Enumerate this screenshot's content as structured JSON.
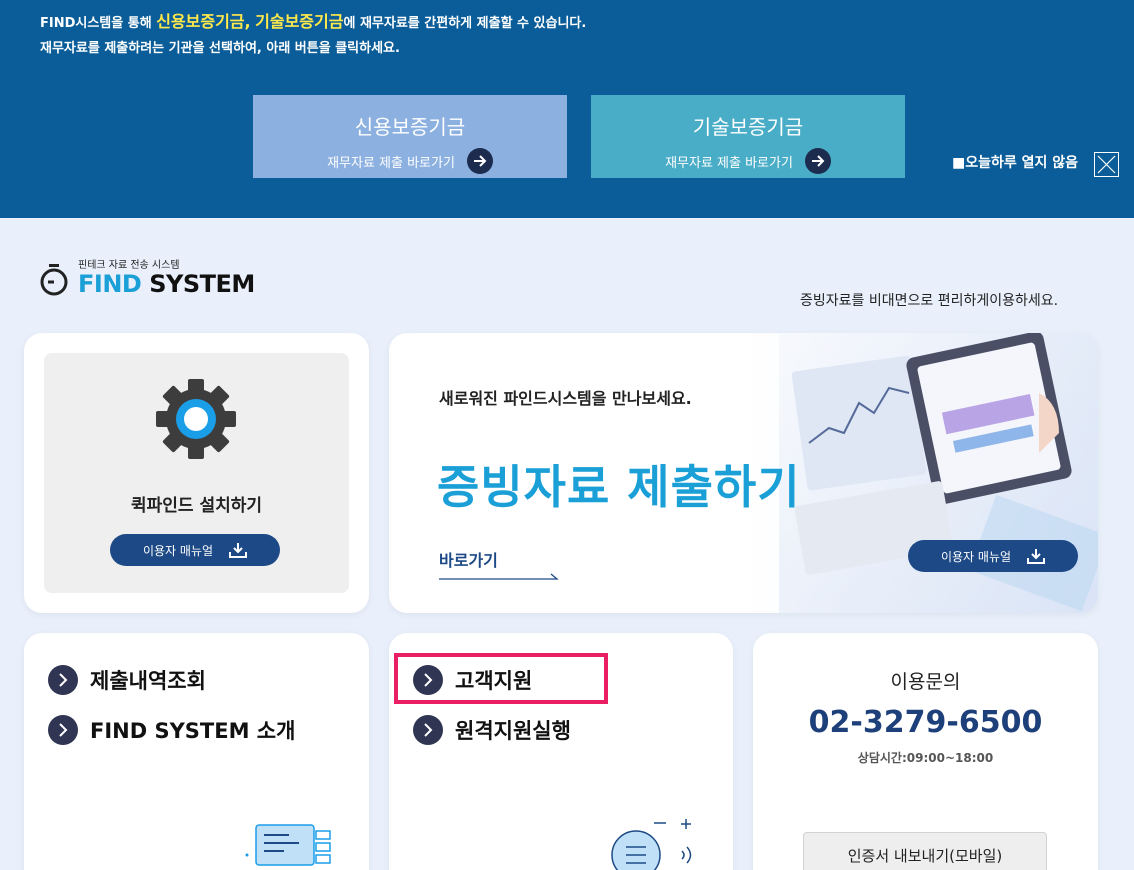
{
  "banner": {
    "line1_prefix": "FIND시스템을 통해 ",
    "line1_fund1": "신용보증기금,",
    "line1_fund2": "기술보증기금",
    "line1_suffix": "에 재무자료를 간편하게 제출할 수 있습니다.",
    "line2": "재무자료를 제출하려는 기관을 선택하여, 아래 버튼을 클릭하세요.",
    "buttons": [
      {
        "name": "신용보증기금",
        "sub": "재무자료 제출 바로가기"
      },
      {
        "name": "기술보증기금",
        "sub": "재무자료 제출 바로가기"
      }
    ],
    "no_show_today": "■오늘하루 열지 않음",
    "colors": {
      "background": "#0a5d98",
      "highlight": "#ffe94a",
      "credit_button": "#8cb1e0",
      "tech_button": "#4aadc7"
    }
  },
  "logo": {
    "sub": "핀테크 자료 전송 시스템",
    "main_find": "FIND",
    "main_system": " SYSTEM"
  },
  "tagline": "증빙자료를 비대면으로 편리하게이용하세요.",
  "install_card": {
    "title": "퀵파인드 설치하기",
    "manual_button": "이용자 매뉴얼",
    "icon": "gear-icon"
  },
  "submit_card": {
    "intro": "새로워진 파인드시스템을 만나보세요.",
    "headline": "증빙자료 제출하기",
    "goto": "바로가기",
    "manual_button": "이용자 매뉴얼"
  },
  "menu_left": [
    {
      "label": "제출내역조회"
    },
    {
      "label": "FIND SYSTEM 소개"
    }
  ],
  "menu_mid": [
    {
      "label": "고객지원"
    },
    {
      "label": "원격지원실행"
    }
  ],
  "contact": {
    "title": "이용문의",
    "phone": "02-3279-6500",
    "hours": "상담시간:09:00~18:00",
    "cert_button": "인증서 내보내기(모바일)"
  }
}
